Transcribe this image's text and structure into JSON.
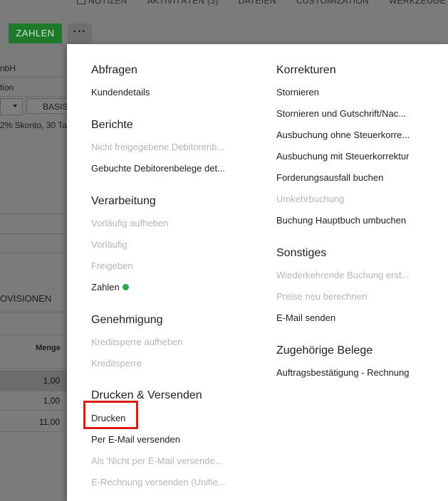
{
  "topnav": [
    "NOTIZEN",
    "AKTIVITÄTEN (3)",
    "DATEIEN",
    "CUSTOMIZATION",
    "WERKZEUGE"
  ],
  "toolbar": {
    "pay_label": "ZAHLEN",
    "more_label": "···"
  },
  "background": {
    "company_suffix": "nbH",
    "field_frag": "tion",
    "basis_label": "BASIS",
    "terms_frag": "2% Skonto, 30 Ta",
    "tab_frag": "OVISIONEN",
    "qty_header": "Menge",
    "qty_values": [
      "1,00",
      "1,00",
      "11,00"
    ]
  },
  "menu": {
    "left": [
      {
        "title": "Abfragen",
        "items": [
          {
            "label": "Kundendetails",
            "enabled": true
          }
        ]
      },
      {
        "title": "Berichte",
        "items": [
          {
            "label": "Nicht freigegebene Debitorenb...",
            "enabled": false
          },
          {
            "label": "Gebuchte Debitorenbelege det...",
            "enabled": true
          }
        ]
      },
      {
        "title": "Verarbeitung",
        "items": [
          {
            "label": "Vorläufig aufheben",
            "enabled": false
          },
          {
            "label": "Vorläufig",
            "enabled": false
          },
          {
            "label": "Freigeben",
            "enabled": false
          },
          {
            "label": "Zahlen",
            "enabled": true
          }
        ]
      },
      {
        "title": "Genehmigung",
        "items": [
          {
            "label": "Kreditsperre aufheben",
            "enabled": false
          },
          {
            "label": "Kreditsperre",
            "enabled": false
          }
        ]
      },
      {
        "title": "Drucken & Versenden",
        "items": [
          {
            "label": "Drucken",
            "enabled": true
          },
          {
            "label": "Per E-Mail versenden",
            "enabled": true
          },
          {
            "label": "Als 'Nicht per E-Mail versende...",
            "enabled": false
          },
          {
            "label": "E-Rechnung versenden (Unifie...",
            "enabled": false
          }
        ]
      }
    ],
    "right": [
      {
        "title": "Korrekturen",
        "items": [
          {
            "label": "Stornieren",
            "enabled": true
          },
          {
            "label": "Stornieren und Gutschrift/Nac...",
            "enabled": true
          },
          {
            "label": "Ausbuchung ohne Steuerkorre...",
            "enabled": true
          },
          {
            "label": "Ausbuchung mit Steuerkorrektur",
            "enabled": true
          },
          {
            "label": "Forderungsausfall buchen",
            "enabled": true
          },
          {
            "label": "Umkehrbuchung",
            "enabled": false
          },
          {
            "label": "Buchung Hauptbuch umbuchen",
            "enabled": true
          }
        ]
      },
      {
        "title": "Sonstiges",
        "items": [
          {
            "label": "Wiederkehrende Buchung erst...",
            "enabled": false
          },
          {
            "label": "Preise neu berechnen",
            "enabled": false
          },
          {
            "label": "E-Mail senden",
            "enabled": true
          }
        ]
      },
      {
        "title": "Zugehörige Belege",
        "items": [
          {
            "label": "Auftragsbestätigung - Rechnung",
            "enabled": true
          }
        ]
      }
    ]
  },
  "colors": {
    "accent_green": "#1d7a2c",
    "status_dot": "#2aa84a",
    "highlight_red": "#d91b1b"
  }
}
